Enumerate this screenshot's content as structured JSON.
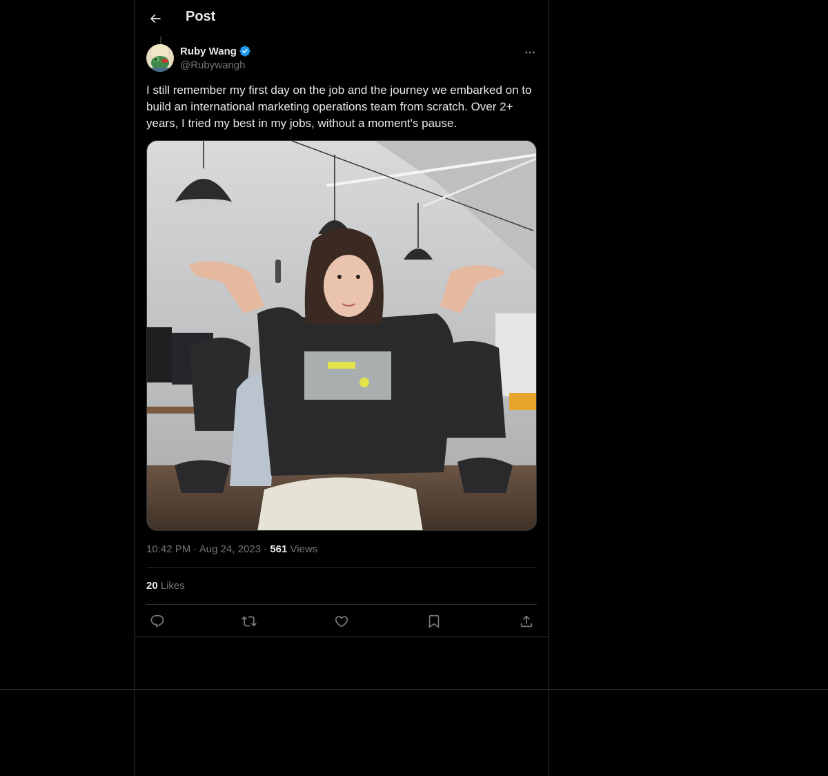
{
  "header": {
    "title": "Post"
  },
  "author": {
    "name": "Ruby Wang",
    "handle": "@Rubywangh",
    "verified": true,
    "verified_color": "#1d9bf0"
  },
  "post": {
    "text": "I still remember my first day on the job and the journey we embarked on to build an international marketing operations team from scratch. Over 2+ years, I tried my best in my jobs, without a moment's pause.",
    "time": "10:42 PM",
    "date": "Aug 24, 2023",
    "views_count": "561",
    "views_label": "Views",
    "likes_count": "20",
    "likes_label": "Likes"
  },
  "icons": {
    "back": "arrow-left-icon",
    "more": "more-horizontal-icon",
    "reply": "reply-icon",
    "repost": "repost-icon",
    "like": "heart-icon",
    "bookmark": "bookmark-icon",
    "share": "share-icon"
  },
  "colors": {
    "background": "#000000",
    "text": "#e7e9ea",
    "secondary": "#71767b",
    "border": "#2f3336",
    "accent": "#1d9bf0"
  }
}
